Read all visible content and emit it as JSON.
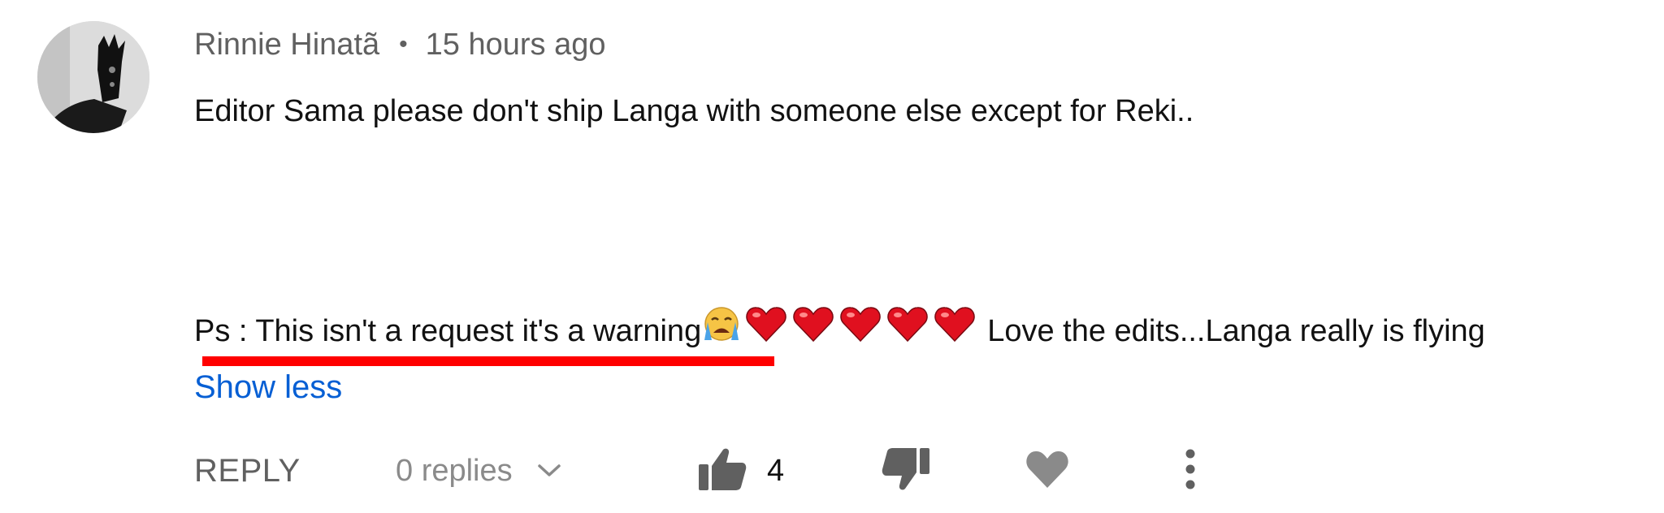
{
  "comment": {
    "author": "Rinnie Hinatã",
    "separator": "•",
    "timestamp": "15 hours ago",
    "text_line1": "Editor Sama please don't ship Langa with someone else except for Reki..",
    "text_line2_prefix": "Ps : This isn't a request it's a warning",
    "text_line2_suffix": "Love the edits...Langa really is flying",
    "emojis": [
      "crying-face-icon",
      "red-heart-icon",
      "red-heart-icon",
      "red-heart-icon",
      "red-heart-icon",
      "red-heart-icon"
    ],
    "show_less_label": "Show less"
  },
  "actions": {
    "reply_label": "REPLY",
    "replies_label": "0 replies",
    "like_count": "4"
  },
  "colors": {
    "meta_text": "#606060",
    "link_blue": "#065fd4",
    "underline_red": "#ff0000",
    "heart_red": "#e0101f",
    "icon_gray": "#606060"
  }
}
